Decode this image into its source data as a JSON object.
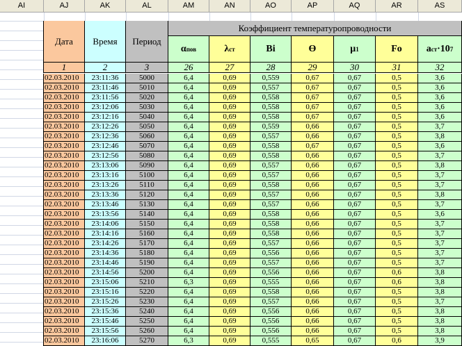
{
  "spreadsheet": {
    "column_letters": [
      "AI",
      "AJ",
      "AK",
      "AL",
      "AM",
      "AN",
      "AO",
      "AP",
      "AQ",
      "AR",
      "AS"
    ],
    "header": {
      "date": "Дата",
      "time": "Время",
      "period": "Период",
      "group_title": "Коэффициент температуропроводности",
      "alpha": {
        "base": "α",
        "sub": "пов"
      },
      "lambda": {
        "base": "λ",
        "sub": "ст"
      },
      "bi": "Bi",
      "theta": "ϴ",
      "mu": {
        "base": "μ",
        "sub": "1"
      },
      "fo": "Fo",
      "a": {
        "base": "a",
        "sub": "ст",
        "mid": "·10",
        "sup": "7"
      }
    },
    "column_numbers": [
      "1",
      "2",
      "3",
      "26",
      "27",
      "28",
      "29",
      "30",
      "31",
      "32"
    ],
    "rows": [
      [
        "02.03.2010",
        "23:11:36",
        "5000",
        "6,4",
        "0,69",
        "0,559",
        "0,67",
        "0,67",
        "0,5",
        "3,6"
      ],
      [
        "02.03.2010",
        "23:11:46",
        "5010",
        "6,4",
        "0,69",
        "0,557",
        "0,67",
        "0,67",
        "0,5",
        "3,6"
      ],
      [
        "02.03.2010",
        "23:11:56",
        "5020",
        "6,4",
        "0,69",
        "0,558",
        "0,67",
        "0,67",
        "0,5",
        "3,6"
      ],
      [
        "02.03.2010",
        "23:12:06",
        "5030",
        "6,4",
        "0,69",
        "0,558",
        "0,67",
        "0,67",
        "0,5",
        "3,6"
      ],
      [
        "02.03.2010",
        "23:12:16",
        "5040",
        "6,4",
        "0,69",
        "0,558",
        "0,67",
        "0,67",
        "0,5",
        "3,6"
      ],
      [
        "02.03.2010",
        "23:12:26",
        "5050",
        "6,4",
        "0,69",
        "0,559",
        "0,66",
        "0,67",
        "0,5",
        "3,7"
      ],
      [
        "02.03.2010",
        "23:12:36",
        "5060",
        "6,4",
        "0,69",
        "0,557",
        "0,66",
        "0,67",
        "0,5",
        "3,8"
      ],
      [
        "02.03.2010",
        "23:12:46",
        "5070",
        "6,4",
        "0,69",
        "0,558",
        "0,67",
        "0,67",
        "0,5",
        "3,6"
      ],
      [
        "02.03.2010",
        "23:12:56",
        "5080",
        "6,4",
        "0,69",
        "0,558",
        "0,66",
        "0,67",
        "0,5",
        "3,7"
      ],
      [
        "02.03.2010",
        "23:13:06",
        "5090",
        "6,4",
        "0,69",
        "0,557",
        "0,66",
        "0,67",
        "0,5",
        "3,8"
      ],
      [
        "02.03.2010",
        "23:13:16",
        "5100",
        "6,4",
        "0,69",
        "0,557",
        "0,66",
        "0,67",
        "0,5",
        "3,7"
      ],
      [
        "02.03.2010",
        "23:13:26",
        "5110",
        "6,4",
        "0,69",
        "0,558",
        "0,66",
        "0,67",
        "0,5",
        "3,7"
      ],
      [
        "02.03.2010",
        "23:13:36",
        "5120",
        "6,4",
        "0,69",
        "0,557",
        "0,66",
        "0,67",
        "0,5",
        "3,8"
      ],
      [
        "02.03.2010",
        "23:13:46",
        "5130",
        "6,4",
        "0,69",
        "0,557",
        "0,66",
        "0,67",
        "0,5",
        "3,7"
      ],
      [
        "02.03.2010",
        "23:13:56",
        "5140",
        "6,4",
        "0,69",
        "0,558",
        "0,66",
        "0,67",
        "0,5",
        "3,6"
      ],
      [
        "02.03.2010",
        "23:14:06",
        "5150",
        "6,4",
        "0,69",
        "0,558",
        "0,66",
        "0,67",
        "0,5",
        "3,7"
      ],
      [
        "02.03.2010",
        "23:14:16",
        "5160",
        "6,4",
        "0,69",
        "0,558",
        "0,66",
        "0,67",
        "0,5",
        "3,7"
      ],
      [
        "02.03.2010",
        "23:14:26",
        "5170",
        "6,4",
        "0,69",
        "0,557",
        "0,66",
        "0,67",
        "0,5",
        "3,7"
      ],
      [
        "02.03.2010",
        "23:14:36",
        "5180",
        "6,4",
        "0,69",
        "0,556",
        "0,66",
        "0,67",
        "0,5",
        "3,7"
      ],
      [
        "02.03.2010",
        "23:14:46",
        "5190",
        "6,4",
        "0,69",
        "0,557",
        "0,66",
        "0,67",
        "0,5",
        "3,7"
      ],
      [
        "02.03.2010",
        "23:14:56",
        "5200",
        "6,4",
        "0,69",
        "0,556",
        "0,66",
        "0,67",
        "0,6",
        "3,8"
      ],
      [
        "02.03.2010",
        "23:15:06",
        "5210",
        "6,3",
        "0,69",
        "0,555",
        "0,66",
        "0,67",
        "0,6",
        "3,8"
      ],
      [
        "02.03.2010",
        "23:15:16",
        "5220",
        "6,4",
        "0,69",
        "0,558",
        "0,66",
        "0,67",
        "0,5",
        "3,8"
      ],
      [
        "02.03.2010",
        "23:15:26",
        "5230",
        "6,4",
        "0,69",
        "0,557",
        "0,66",
        "0,67",
        "0,5",
        "3,7"
      ],
      [
        "02.03.2010",
        "23:15:36",
        "5240",
        "6,4",
        "0,69",
        "0,556",
        "0,66",
        "0,67",
        "0,5",
        "3,8"
      ],
      [
        "02.03.2010",
        "23:15:46",
        "5250",
        "6,4",
        "0,69",
        "0,556",
        "0,66",
        "0,67",
        "0,5",
        "3,8"
      ],
      [
        "02.03.2010",
        "23:15:56",
        "5260",
        "6,4",
        "0,69",
        "0,556",
        "0,66",
        "0,67",
        "0,5",
        "3,8"
      ],
      [
        "02.03.2010",
        "23:16:06",
        "5270",
        "6,3",
        "0,69",
        "0,555",
        "0,65",
        "0,67",
        "0,6",
        "3,9"
      ]
    ],
    "colors": {
      "date_fill": "#fbc89e",
      "time_fill": "#ccffff",
      "period_fill": "#c0c0c0",
      "green_fill": "#ccffcc",
      "yellow_fill": "#ffff99",
      "header_bar": "#ece9d8"
    }
  }
}
